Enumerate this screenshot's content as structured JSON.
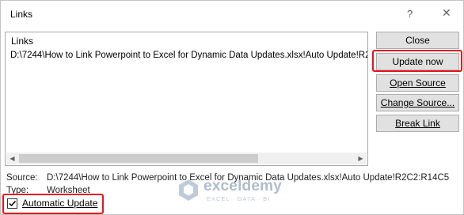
{
  "dialog": {
    "title": "Links",
    "help_glyph": "?",
    "close_glyph": "✕"
  },
  "links_list": {
    "header": "Links",
    "items": [
      "D:\\7244\\How to Link Powerpoint to Excel for Dynamic Data Updates.xlsx!Auto Update!R2C2:R14C5"
    ]
  },
  "buttons": {
    "close": "Close",
    "update_now": "Update now",
    "open_source": "Open Source",
    "change_source": "Change Source...",
    "break_link": "Break Link"
  },
  "info": {
    "source_label": "Source:",
    "source_value": "D:\\7244\\How to Link Powerpoint to Excel for Dynamic Data Updates.xlsx!Auto Update!R2C2:R14C5",
    "type_label": "Type:",
    "type_value": "Worksheet"
  },
  "automatic_update": {
    "label": "Automatic Update",
    "checked": true
  },
  "watermark": {
    "name": "exceldemy",
    "tagline": "EXCEL · DATA · BI"
  },
  "colors": {
    "highlight": "#e8141c",
    "button_face": "#e1e1e1"
  }
}
